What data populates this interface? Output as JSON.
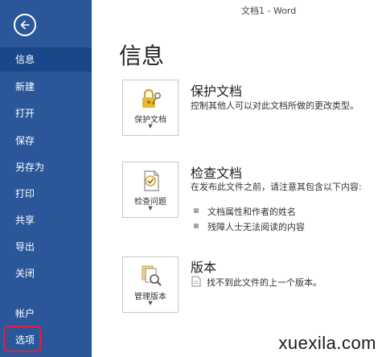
{
  "window_title": "文档1 - Word",
  "page_title": "信息",
  "sidebar": {
    "items": [
      {
        "label": "信息"
      },
      {
        "label": "新建"
      },
      {
        "label": "打开"
      },
      {
        "label": "保存"
      },
      {
        "label": "另存为"
      },
      {
        "label": "打印"
      },
      {
        "label": "共享"
      },
      {
        "label": "导出"
      },
      {
        "label": "关闭"
      },
      {
        "label": "帐户"
      },
      {
        "label": "选项"
      }
    ],
    "active_index": 0,
    "highlight_color": "#e0203b",
    "background_color": "#2b579a"
  },
  "sections": [
    {
      "button_label": "保护文档",
      "title": "保护文档",
      "description": "控制其他人可以对此文档所做的更改类型。"
    },
    {
      "button_label": "检查问题",
      "title": "检查文档",
      "description": "在发布此文件之前，请注意其包含以下内容:",
      "bullets": [
        "文档属性和作者的姓名",
        "残障人士无法阅读的内容"
      ]
    },
    {
      "button_label": "管理版本",
      "title": "版本",
      "description": "找不到此文件的上一个版本。"
    }
  ],
  "icons": {
    "back": "back-arrow-icon",
    "protect": "lock-key-icon",
    "inspect": "inspect-document-icon",
    "versions": "manage-versions-icon",
    "no_versions": "document-icon"
  },
  "watermark": "xuexila.com"
}
